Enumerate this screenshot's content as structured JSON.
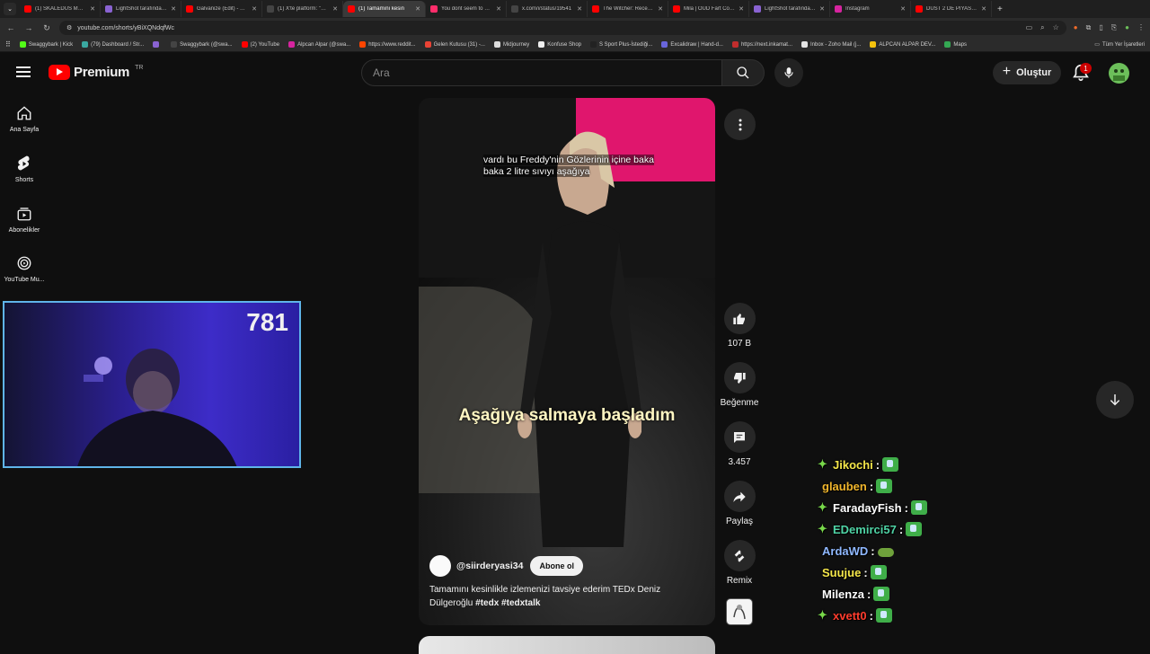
{
  "browser": {
    "tabs": [
      {
        "title": "(1) SKALEDUS MORTUS",
        "color": "#ff0000"
      },
      {
        "title": "LightShot tarafından k",
        "color": "#8a63d2"
      },
      {
        "title": "Galvanize (Edit) - YouT",
        "color": "#ff0000"
      },
      {
        "title": "(1) X'te platform: \"Filmi",
        "color": "#444444"
      },
      {
        "title": "(1) Tamamını kesin",
        "color": "#ff0000",
        "active": true
      },
      {
        "title": "You dont seem to unde",
        "color": "#ff2d6b"
      },
      {
        "title": "x.com/i/status/19541",
        "color": "#444444"
      },
      {
        "title": "The Witcher: Recevent",
        "color": "#ff0000"
      },
      {
        "title": "Mila | OUD Fart Compi",
        "color": "#ff0000"
      },
      {
        "title": "LightShot tarafından k",
        "color": "#8a63d2"
      },
      {
        "title": "Instagram",
        "color": "#d6249f"
      },
      {
        "title": "DUST 2 DE PIYASA MA",
        "color": "#ff0000"
      }
    ],
    "url": "youtube.com/shorts/yBiXQNdqfWc",
    "bookmarks": [
      {
        "label": "Swaggybark | Kick",
        "color": "#53fc18"
      },
      {
        "label": "(79) Dashboard / Str...",
        "color": "#3aa8a0"
      },
      {
        "label": "",
        "color": "#8a63d2"
      },
      {
        "label": "Swaggybark (@swa...",
        "color": "#444444"
      },
      {
        "label": "(2) YouTube",
        "color": "#ff0000"
      },
      {
        "label": "Alpcan Alpar (@swa...",
        "color": "#d6249f"
      },
      {
        "label": "https://www.reddit...",
        "color": "#ff4500"
      },
      {
        "label": "Gelen Kutusu (31) -...",
        "color": "#ea4335"
      },
      {
        "label": "Midjourney",
        "color": "#dddddd"
      },
      {
        "label": "Konfuse Shop",
        "color": "#eeeeee"
      },
      {
        "label": "S Sport Plus-İstediği...",
        "color": "#222222"
      },
      {
        "label": "Excalidraw | Hand-d...",
        "color": "#6965db"
      },
      {
        "label": "https://next.inkamat...",
        "color": "#c22d2d"
      },
      {
        "label": "Inbox - Zoho Mail (j...",
        "color": "#e4e4e4"
      },
      {
        "label": "ALPCAN ALPAR DEV...",
        "color": "#f4c20d"
      },
      {
        "label": "Maps",
        "color": "#34a853"
      }
    ],
    "all_bookmarks": "Tüm Yer İşaretleri"
  },
  "header": {
    "logo_text": "Premium",
    "country": "TR",
    "search_placeholder": "Ara",
    "create_label": "Oluştur",
    "notification_count": "1"
  },
  "sidebar": {
    "items": [
      {
        "label": "Ana Sayfa",
        "icon": "home-icon"
      },
      {
        "label": "Shorts",
        "icon": "shorts-icon"
      },
      {
        "label": "Abonelikler",
        "icon": "subscriptions-icon"
      },
      {
        "label": "YouTube Mu...",
        "icon": "youtube-music-icon"
      }
    ]
  },
  "webcam": {
    "counter": "781"
  },
  "video": {
    "caption_top": "vardı bu Freddy'nin Gözlerinin içine baka baka 2 litre sıvıyı aşağıya",
    "caption_main": "Aşağıya salmaya başladım",
    "channel": "@siirderyasi34",
    "subscribe_label": "Abone ol",
    "description": "Tamamını kesinlikle izlemenizi tavsiye ederim TEDx Deniz Dülgeroğlu",
    "hashtags": "#tedx #tedxtalk"
  },
  "actions": {
    "like_count": "107 B",
    "dislike_label": "Beğenme",
    "comment_count": "3.457",
    "share_label": "Paylaş",
    "remix_label": "Remix"
  },
  "chat": [
    {
      "user": "Jikochi",
      "color": "#f4e64a",
      "badge": true
    },
    {
      "user": "glauben",
      "color": "#f0b52c",
      "badge": false
    },
    {
      "user": "FaradayFish",
      "color": "#ffffff",
      "badge": true
    },
    {
      "user": "EDemirci57",
      "color": "#4fd3a5",
      "badge": true
    },
    {
      "user": "ArdaWD",
      "color": "#8fb8ff",
      "badge": false,
      "frog": true
    },
    {
      "user": "Suujue",
      "color": "#f4e64a",
      "badge": false
    },
    {
      "user": "Milenza",
      "color": "#ffffff",
      "badge": false
    },
    {
      "user": "xvett0",
      "color": "#ff3d2e",
      "badge": true
    }
  ]
}
